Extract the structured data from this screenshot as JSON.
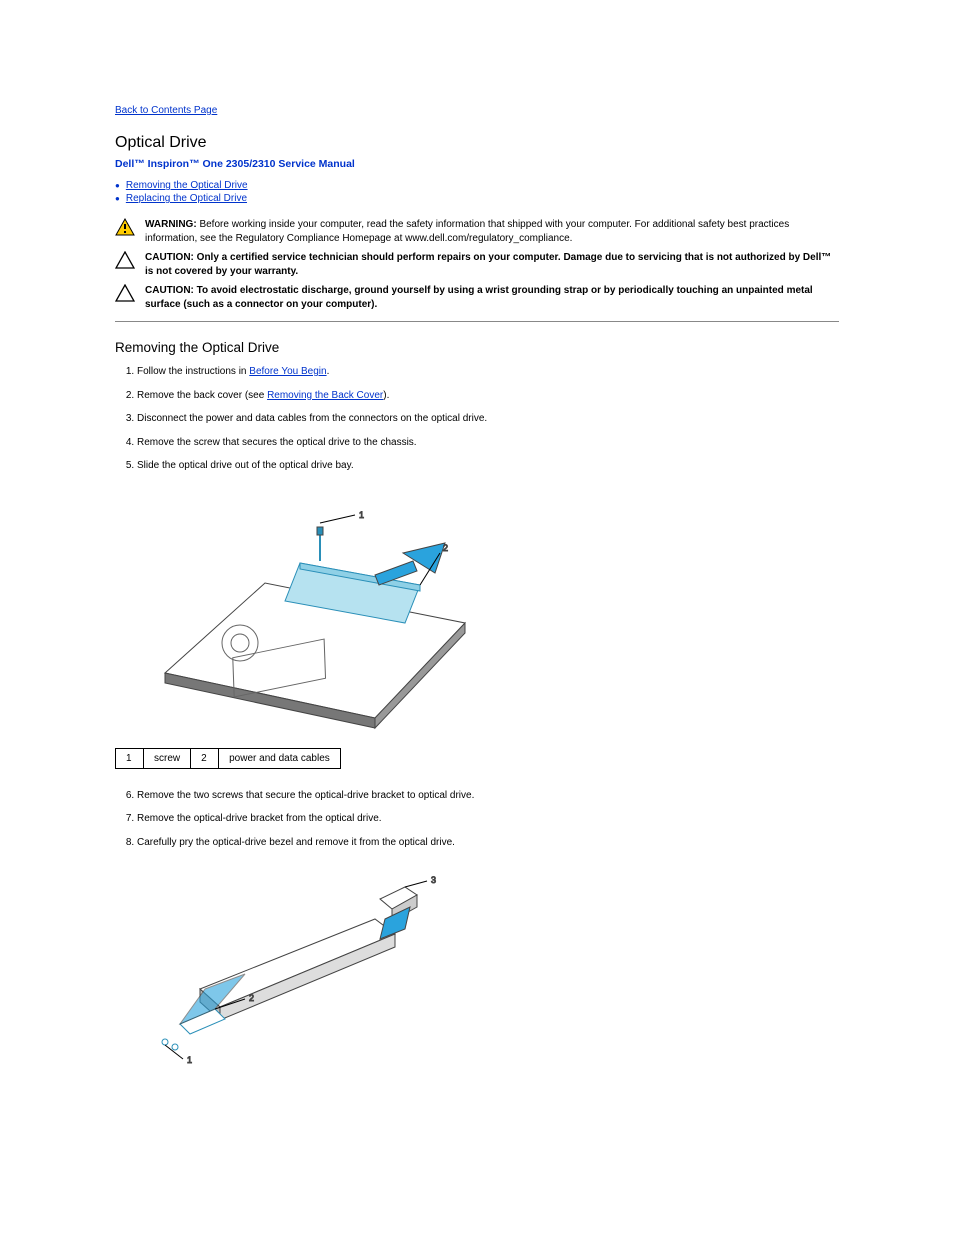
{
  "back_link": "Back to Contents Page",
  "title": "Optical Drive",
  "subtitle": "Dell™ Inspiron™ One 2305/2310 Service Manual",
  "bullets": [
    "Removing the Optical Drive",
    "Replacing the Optical Drive"
  ],
  "notices": {
    "warning": {
      "label": "WARNING:",
      "text": "Before working inside your computer, read the safety information that shipped with your computer. For additional safety best practices information, see the Regulatory Compliance Homepage at www.dell.com/regulatory_compliance."
    },
    "caution1": {
      "label": "CAUTION:",
      "text": "Only a certified service technician should perform repairs on your computer. Damage due to servicing that is not authorized by Dell™ is not covered by your warranty."
    },
    "caution2": {
      "label": "CAUTION:",
      "text": "To avoid electrostatic discharge, ground yourself by using a wrist grounding strap or by periodically touching an unpainted metal surface (such as a connector on your computer)."
    }
  },
  "section_title": "Removing the Optical Drive",
  "steps_a": [
    {
      "pre": "Follow the instructions in ",
      "link": "Before You Begin",
      "post": "."
    },
    {
      "pre": "Remove the back cover (see ",
      "link": "Removing the Back Cover",
      "post": ")."
    },
    {
      "pre": "Disconnect the power and data cables from the connectors on the optical drive.",
      "link": "",
      "post": ""
    },
    {
      "pre": "Remove the screw that secures the optical drive to the chassis.",
      "link": "",
      "post": ""
    },
    {
      "pre": "Slide the optical drive out of the optical drive bay.",
      "link": "",
      "post": ""
    }
  ],
  "legend1": {
    "c1n": "1",
    "c1t": "screw",
    "c2n": "2",
    "c2t": "power and data cables"
  },
  "steps_b": [
    {
      "pre": "Remove the two screws that secure the optical-drive bracket to optical drive.",
      "link": "",
      "post": ""
    },
    {
      "pre": "Remove the optical-drive bracket from the optical drive.",
      "link": "",
      "post": ""
    },
    {
      "pre": "Carefully pry the optical-drive bezel and remove it from the optical drive.",
      "link": "",
      "post": ""
    }
  ]
}
